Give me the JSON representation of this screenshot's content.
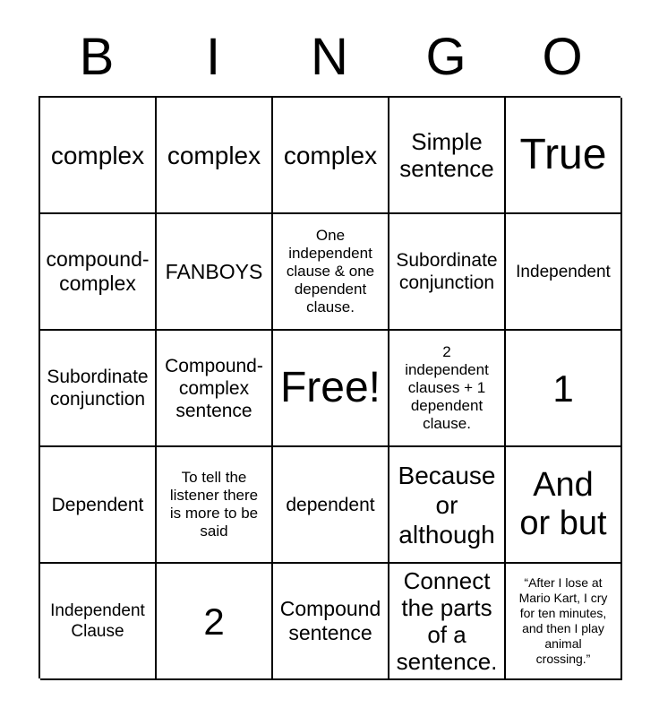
{
  "header": {
    "letters": [
      "B",
      "I",
      "N",
      "G",
      "O"
    ]
  },
  "grid": {
    "columns": 5,
    "rows": 5,
    "border_color": "#000000",
    "background_color": "#ffffff",
    "text_color": "#000000",
    "free_space": {
      "row": 3,
      "column": 3,
      "label": "Free!"
    }
  },
  "cells": [
    {
      "text": "complex",
      "size": "s-xxl"
    },
    {
      "text": "complex",
      "size": "s-xxl"
    },
    {
      "text": "complex",
      "size": "s-xxl"
    },
    {
      "text": "Simple\nsentence",
      "size": "s-xl"
    },
    {
      "text": "True",
      "size": "s-h3"
    },
    {
      "text": "compound-\ncomplex",
      "size": "s-lg"
    },
    {
      "text": "FANBOYS",
      "size": "s-lg"
    },
    {
      "text": "One\nindependent\nclause & one\ndependent\nclause.",
      "size": "s-sm"
    },
    {
      "text": "Subordinate\nconjunction",
      "size": "s-lgm"
    },
    {
      "text": "Independent",
      "size": "s-md"
    },
    {
      "text": "Subordinate\nconjunction",
      "size": "s-lgm"
    },
    {
      "text": "Compound-\ncomplex\nsentence",
      "size": "s-lgm"
    },
    {
      "text": "Free!",
      "size": "s-h3"
    },
    {
      "text": "2\nindependent\nclauses + 1\ndependent\nclause.",
      "size": "s-sm"
    },
    {
      "text": "1",
      "size": "s-h2"
    },
    {
      "text": "Dependent",
      "size": "s-lgm"
    },
    {
      "text": "To tell the\nlistener there\nis more to be\nsaid",
      "size": "s-sm"
    },
    {
      "text": "dependent",
      "size": "s-lgm"
    },
    {
      "text": "Because\nor\nalthough",
      "size": "s-xxl"
    },
    {
      "text": "And\nor but",
      "size": "s-h1"
    },
    {
      "text": "Independent\nClause",
      "size": "s-md"
    },
    {
      "text": "2",
      "size": "s-h2"
    },
    {
      "text": "Compound\nsentence",
      "size": "s-lg"
    },
    {
      "text": "Connect\nthe parts\nof a\nsentence.",
      "size": "s-xl"
    },
    {
      "text": "“After I lose at\nMario Kart, I cry\nfor ten minutes,\nand then I play\nanimal\ncrossing.”",
      "size": "s-xs"
    }
  ]
}
